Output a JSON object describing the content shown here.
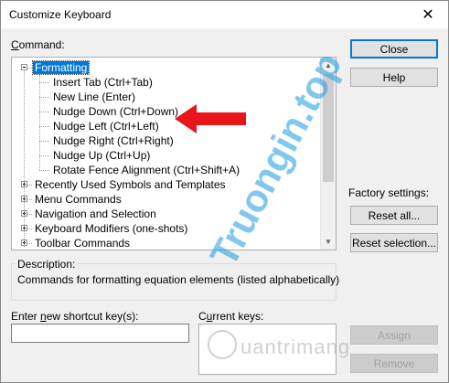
{
  "window": {
    "title": "Customize Keyboard",
    "close_glyph": "✕"
  },
  "command": {
    "label_pre": "",
    "label_underline": "C",
    "label_post": "ommand:"
  },
  "tree": {
    "items": [
      {
        "label": "Formatting",
        "level": 0,
        "expander": "minus",
        "selected": true
      },
      {
        "label": "Insert Tab (Ctrl+Tab)",
        "level": 1
      },
      {
        "label": "New Line (Enter)",
        "level": 1
      },
      {
        "label": "Nudge Down (Ctrl+Down)",
        "level": 1
      },
      {
        "label": "Nudge Left (Ctrl+Left)",
        "level": 1
      },
      {
        "label": "Nudge Right (Ctrl+Right)",
        "level": 1
      },
      {
        "label": "Nudge Up (Ctrl+Up)",
        "level": 1
      },
      {
        "label": "Rotate Fence Alignment (Ctrl+Shift+A)",
        "level": 1
      },
      {
        "label": "Recently Used Symbols and Templates",
        "level": 0,
        "expander": "plus"
      },
      {
        "label": "Menu Commands",
        "level": 0,
        "expander": "plus"
      },
      {
        "label": "Navigation and Selection",
        "level": 0,
        "expander": "plus"
      },
      {
        "label": "Keyboard Modifiers (one-shots)",
        "level": 0,
        "expander": "plus"
      },
      {
        "label": "Toolbar Commands",
        "level": 0,
        "expander": "plus"
      }
    ]
  },
  "buttons": {
    "close": "Close",
    "help": "Help",
    "reset_all": "Reset all...",
    "reset_selection": "Reset selection...",
    "assign": "Assign",
    "remove": "Remove"
  },
  "factory": {
    "label": "Factory settings:"
  },
  "description": {
    "label": "Description:",
    "text": "Commands for formatting equation elements  (listed alphabetically)"
  },
  "shortcut": {
    "label_pre": "Enter ",
    "label_underline": "n",
    "label_post": "ew shortcut key(s):",
    "value": ""
  },
  "current": {
    "label_pre": "C",
    "label_underline": "u",
    "label_post": "rrent keys:"
  },
  "watermark": {
    "main": "Truongin.top",
    "secondary": "uantrimang"
  },
  "colors": {
    "accent": "#0078d7",
    "arrow": "#e8151b",
    "watermark": "#1d9be0"
  },
  "icons": {
    "scroll_up": "▲",
    "scroll_down": "▼"
  }
}
